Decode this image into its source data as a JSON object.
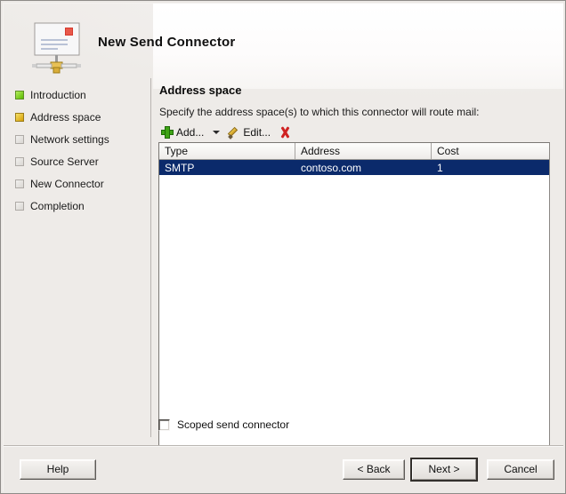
{
  "window": {
    "title": "New Send Connector",
    "icon": "send-connector-icon"
  },
  "steps": [
    {
      "label": "Introduction",
      "state": "done",
      "bullet_color": "#6cc00a"
    },
    {
      "label": "Address space",
      "state": "current",
      "bullet_color": "#d8a40b"
    },
    {
      "label": "Network settings",
      "state": "pending",
      "bullet_color": "#e4e1dd"
    },
    {
      "label": "Source Server",
      "state": "pending",
      "bullet_color": "#e4e1dd"
    },
    {
      "label": "New Connector",
      "state": "pending",
      "bullet_color": "#e4e1dd"
    },
    {
      "label": "Completion",
      "state": "pending",
      "bullet_color": "#e4e1dd"
    }
  ],
  "main": {
    "title": "Address space",
    "description": "Specify the address space(s) to which this connector will route mail:",
    "toolbar": {
      "add_label": "Add...",
      "add_icon": "plus-icon",
      "add_dropdown_icon": "chevron-down-icon",
      "edit_label": "Edit...",
      "edit_icon": "pencil-icon",
      "delete_icon": "red-x-icon"
    },
    "table": {
      "columns": [
        "Type",
        "Address",
        "Cost"
      ],
      "rows": [
        {
          "type": "SMTP",
          "address": "contoso.com",
          "cost": "1",
          "selected": true
        }
      ],
      "selection_color": "#0b2a6b"
    },
    "scrollbar": {
      "left_arrow_icon": "arrow-left-icon",
      "right_arrow_icon": "arrow-right-icon"
    },
    "scoped": {
      "label": "Scoped send connector",
      "checked": false
    }
  },
  "footer": {
    "help_label": "Help",
    "back_label": "< Back",
    "next_label": "Next >",
    "cancel_label": "Cancel"
  }
}
